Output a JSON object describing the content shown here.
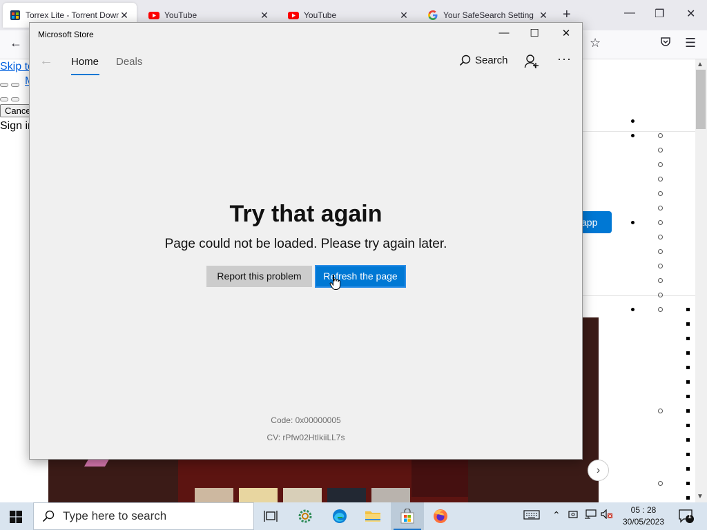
{
  "browser": {
    "tabs": [
      {
        "title": "Torrex Lite - Torrent Downlo",
        "icon": "store-favicon-icon",
        "active": true
      },
      {
        "title": "YouTube",
        "icon": "youtube-icon",
        "active": false
      },
      {
        "title": "YouTube",
        "icon": "youtube-icon",
        "active": false
      },
      {
        "title": "Your SafeSearch Setting",
        "icon": "google-icon",
        "active": false
      }
    ],
    "new_tab": "+",
    "page": {
      "skip_link": "Skip to",
      "menu_link": "M",
      "cancel_label": "Cancel",
      "sign_in": "Sign in",
      "app_button": "app",
      "next_arrow": "›"
    }
  },
  "store": {
    "title": "Microsoft Store",
    "nav": {
      "home": "Home",
      "deals": "Deals",
      "search": "Search"
    },
    "error": {
      "title": "Try that again",
      "message": "Page could not be loaded. Please try again later.",
      "report_button": "Report this problem",
      "refresh_button": "Refresh the page",
      "code": "Code: 0x00000005",
      "cv": "CV: rPfw02HtIkiiLL7s"
    }
  },
  "taskbar": {
    "search_placeholder": "Type here to search",
    "time": "05 : 28",
    "date": "30/05/2023",
    "notification_count": "1"
  },
  "colors": {
    "accent": "#0078d4",
    "taskbar": "#d9e4ef",
    "store_bg": "#f0f0f0"
  }
}
